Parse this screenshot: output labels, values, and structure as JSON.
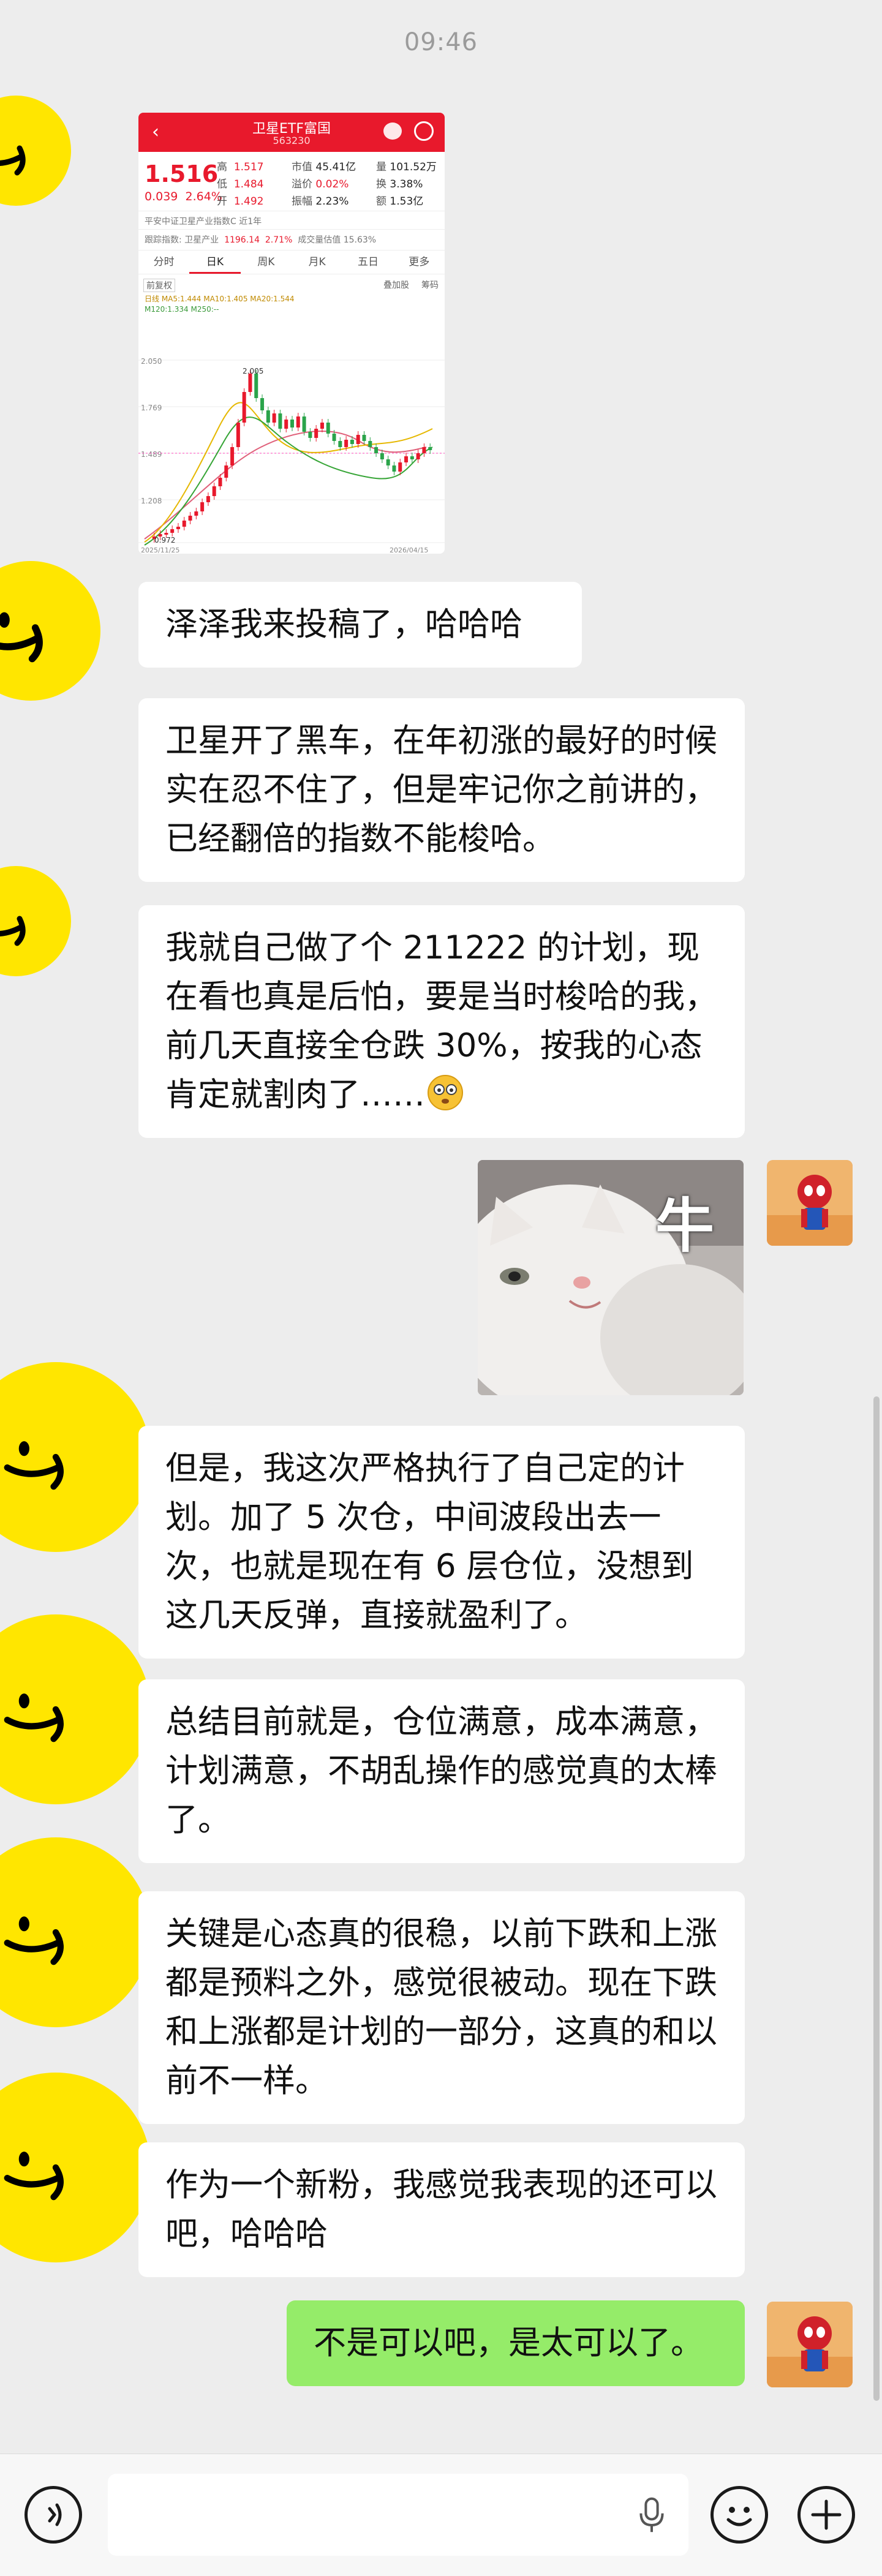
{
  "status_time": "09:46",
  "stock": {
    "title": "卫星ETF富国",
    "code": "563230",
    "price": "1.516",
    "change": "0.039",
    "change_pct": "2.64%",
    "high_label": "高",
    "high": "1.517",
    "low_label": "低",
    "low": "1.484",
    "open_label": "开",
    "open": "1.492",
    "mktcap_label": "市值",
    "mktcap": "45.41亿",
    "premium_label": "溢价",
    "premium": "0.02%",
    "amp_label": "振幅",
    "amp": "2.23%",
    "vol_label": "量",
    "vol": "101.52万",
    "turnover_label": "换",
    "turnover": "3.38%",
    "amount_label": "额",
    "amount": "1.53亿",
    "index_line": "平安中证卫星产业指数C  近1年",
    "track_label": "跟踪指数: 卫星产业",
    "track_value": "1196.14",
    "track_pct": "2.71%",
    "track_tail": "成交量估值 15.63%",
    "tabs": [
      "分时",
      "日K",
      "周K",
      "月K",
      "五日",
      "更多"
    ],
    "active_tab": "日K",
    "opt_left": "前复权",
    "opt_right1": "叠加股",
    "opt_right2": "筹码",
    "ma_line1": "日线 MA5:1.444 MA10:1.405 MA20:1.544",
    "ma_line2": "M120:1.334 M250:--",
    "y_labels": [
      "2.050",
      "1.769",
      "1.489",
      "1.208"
    ],
    "annot_high": "2.005",
    "annot_low": "0.972",
    "date_left": "2025/11/25",
    "date_right": "2026/04/15"
  },
  "messages": [
    {
      "text": "泽泽我来投稿了，哈哈哈"
    },
    {
      "text": "卫星开了黑车，在年初涨的最好的时候实在忍不住了，但是牢记你之前讲的，已经翻倍的指数不能梭哈。"
    },
    {
      "text": "我就自己做了个 211222 的计划，现在看也真是后怕，要是当时梭哈的我，前几天直接全仓跌 30%，按我的心态肯定就割肉了……"
    },
    {
      "text": "但是，我这次严格执行了自己定的计划。加了 5 次仓，中间波段出去一次，也就是现在有 6 层仓位，没想到这几天反弹，直接就盈利了。"
    },
    {
      "text": "总结目前就是，仓位满意，成本满意，计划满意，不胡乱操作的感觉真的太棒了。"
    },
    {
      "text": "关键是心态真的很稳，以前下跌和上涨都是预料之外，感觉很被动。现在下跌和上涨都是计划的一部分，这真的和以前不一样。"
    },
    {
      "text": "作为一个新粉，我感觉我表现的还可以吧，哈哈哈"
    },
    {
      "text": "不是可以吧，是太可以了。"
    }
  ],
  "sticker_text": "牛",
  "colors": {
    "me_bubble": "#95ec69",
    "other_bubble": "#ffffff",
    "avatar": "#ffe600",
    "stock_red": "#e8192c"
  }
}
